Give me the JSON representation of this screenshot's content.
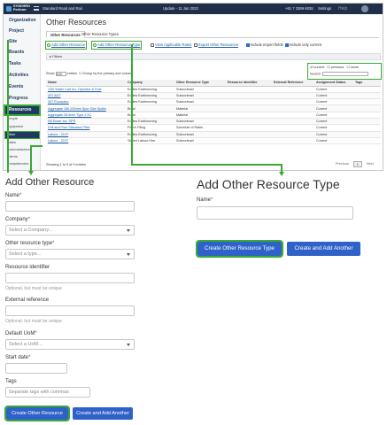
{
  "topbar": {
    "logo_line1": "SYNCHRO",
    "logo_line2": "Perform",
    "project": "Standard Road and Rail",
    "update": "Update - 11 Jan 2022",
    "phone": "+61 7 3369 6038",
    "settings": "Settings",
    "help": "Help"
  },
  "sidebar": {
    "items": [
      "Organization",
      "Project",
      "Site",
      "Boards",
      "Tasks",
      "Activities",
      "Events",
      "Progress",
      "Resources"
    ],
    "active": "Resources",
    "sub_items_a": [
      "People",
      "Equipment"
    ],
    "sub_active": "Other",
    "sub_items_b": [
      "Rates",
      "Subcontractors",
      "Clients",
      "Competencies"
    ]
  },
  "page": {
    "title": "Other Resources",
    "tabs": [
      "Other Resources",
      "Other Resource Types"
    ],
    "actions": {
      "add_other_resource": "Add Other Resource",
      "add_other_resource_type": "Add Other Resource Type",
      "view_applicable_rates": "View Applicable Rates",
      "export": "Export Other Resources",
      "include_import_fields": "Include import fields",
      "include_only_current": "Include only current"
    },
    "filters_label": "Filters",
    "status_filter": {
      "current": "current",
      "previous": "previous",
      "never": "never",
      "search_label": "Search:"
    },
    "show_entries_prefix": "Show",
    "show_entries_value": "100",
    "show_entries_suffix": "entries",
    "group_by": "Group by the primary sort column",
    "footer_info": "Showing 1 to 9 of 9 entries",
    "pager": {
      "previous": "Previous",
      "page": "1",
      "next": "Next"
    }
  },
  "table": {
    "headers": [
      "Name",
      "Company",
      "Other Resource Type",
      "Resource Identifier",
      "External Reference",
      "Assignment Status",
      "Tags"
    ],
    "rows": [
      [
        "12Kl Water Cart Inc. Operator & Fuel",
        "Eddies Earthmoving",
        "Subcontract",
        "",
        "",
        "Current",
        ""
      ],
      [
        "20T ADT",
        "Eddies Earthmoving",
        "Subcontract",
        "",
        "",
        "Current",
        ""
      ],
      [
        "36T Excavator",
        "Eddies Earthmoving",
        "Subcontract",
        "",
        "",
        "Current",
        ""
      ],
      [
        "Aggregate 150-200mm Spur Size Spalls",
        "Boral",
        "Material",
        "",
        "",
        "Current",
        ""
      ],
      [
        "Aggregate 28.5mm Type 2.3C",
        "Boral",
        "Material",
        "",
        "",
        "Current",
        ""
      ],
      [
        "D8 Dozer Inc. GPS",
        "Eddies Earthmoving",
        "Subcontract",
        "",
        "",
        "Current",
        ""
      ],
      [
        "Drill and Pour Standard Piles",
        "Pete's Piling",
        "Schedule of Rates",
        "",
        "",
        "Current",
        ""
      ],
      [
        "Labour - CIVT",
        "Eddies Earthmoving",
        "Subcontract",
        "",
        "",
        "Current",
        ""
      ],
      [
        "Labour - CIVT",
        "Skilled Labour Hire",
        "Subcontract",
        "",
        "",
        "Current",
        ""
      ]
    ]
  },
  "form_resource": {
    "title": "Add Other Resource",
    "name_label": "Name",
    "company_label": "Company",
    "company_placeholder": "Select a Company...",
    "type_label": "Other resource type",
    "type_placeholder": "Select a type...",
    "identifier_label": "Resource identifier",
    "identifier_help": "Optional, but must be unique",
    "external_label": "External reference",
    "external_help": "Optional, but must be unique",
    "uom_label": "Default UoM",
    "uom_placeholder": "Select a UoM...",
    "start_label": "Start date",
    "tags_label": "Tags",
    "tags_placeholder": "Separate tags with commas",
    "create_button": "Create Other Resource",
    "create_another_button": "Create and Add Another",
    "required_mark": "*"
  },
  "form_type": {
    "title": "Add Other Resource Type",
    "name_label": "Name",
    "create_button": "Create Other Resource Type",
    "create_another_button": "Create and Add Another",
    "required_mark": "*"
  },
  "colors": {
    "highlight": "#3aa935",
    "primary_button": "#2f62c8",
    "nav_dark": "#1e3a5f",
    "topbar": "#1f2f4a"
  }
}
